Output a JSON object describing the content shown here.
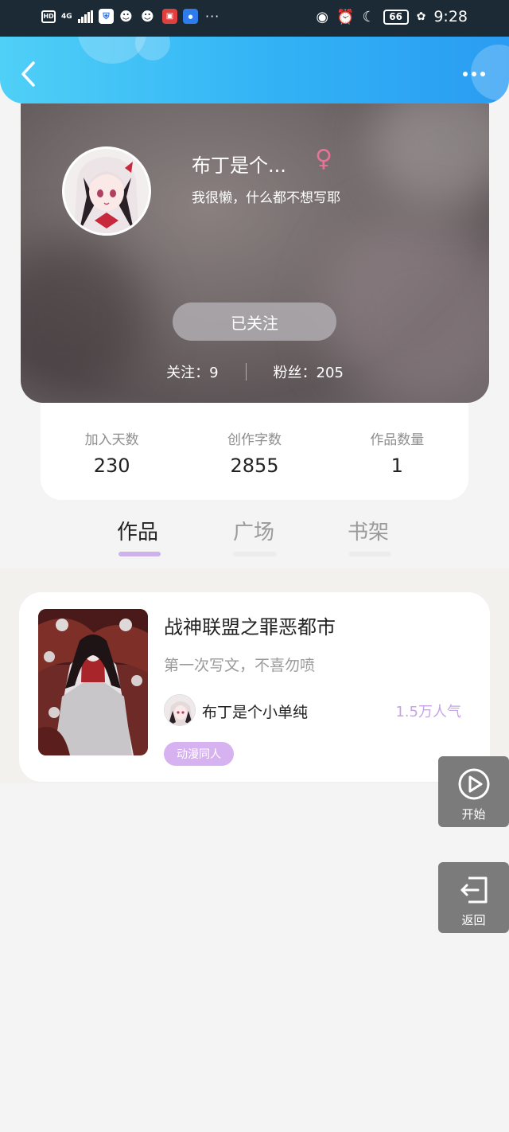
{
  "status_bar": {
    "hd": "HD",
    "network": "4G",
    "time": "9:28",
    "battery": "66",
    "dots": "···"
  },
  "header": {
    "back_icon": "chevron-left-icon",
    "more_icon": "more-horizontal-icon",
    "gradient": [
      "#4fd0f7",
      "#2a9cf2"
    ]
  },
  "profile": {
    "nickname": "布丁是个...",
    "gender_symbol": "♀",
    "bio": "我很懒，什么都不想写耶",
    "follow_button": "已关注",
    "following_label": "关注：",
    "following_count": "9",
    "fans_label": "粉丝：",
    "fans_count": "205"
  },
  "stats": [
    {
      "label": "加入天数",
      "value": "230"
    },
    {
      "label": "创作字数",
      "value": "2855"
    },
    {
      "label": "作品数量",
      "value": "1"
    }
  ],
  "tabs": [
    {
      "label": "作品",
      "active": true
    },
    {
      "label": "广场",
      "active": false
    },
    {
      "label": "书架",
      "active": false
    }
  ],
  "work": {
    "title": "战神联盟之罪恶都市",
    "description": "第一次写文，不喜勿喷",
    "author": "布丁是个小单纯",
    "popularity": "1.5万人气",
    "tag": "动漫同人",
    "accent_color": "#c7a4e6"
  },
  "floating": {
    "start_label": "开始",
    "start_icon": "play-circle-icon",
    "return_label": "返回",
    "return_icon": "exit-icon"
  }
}
